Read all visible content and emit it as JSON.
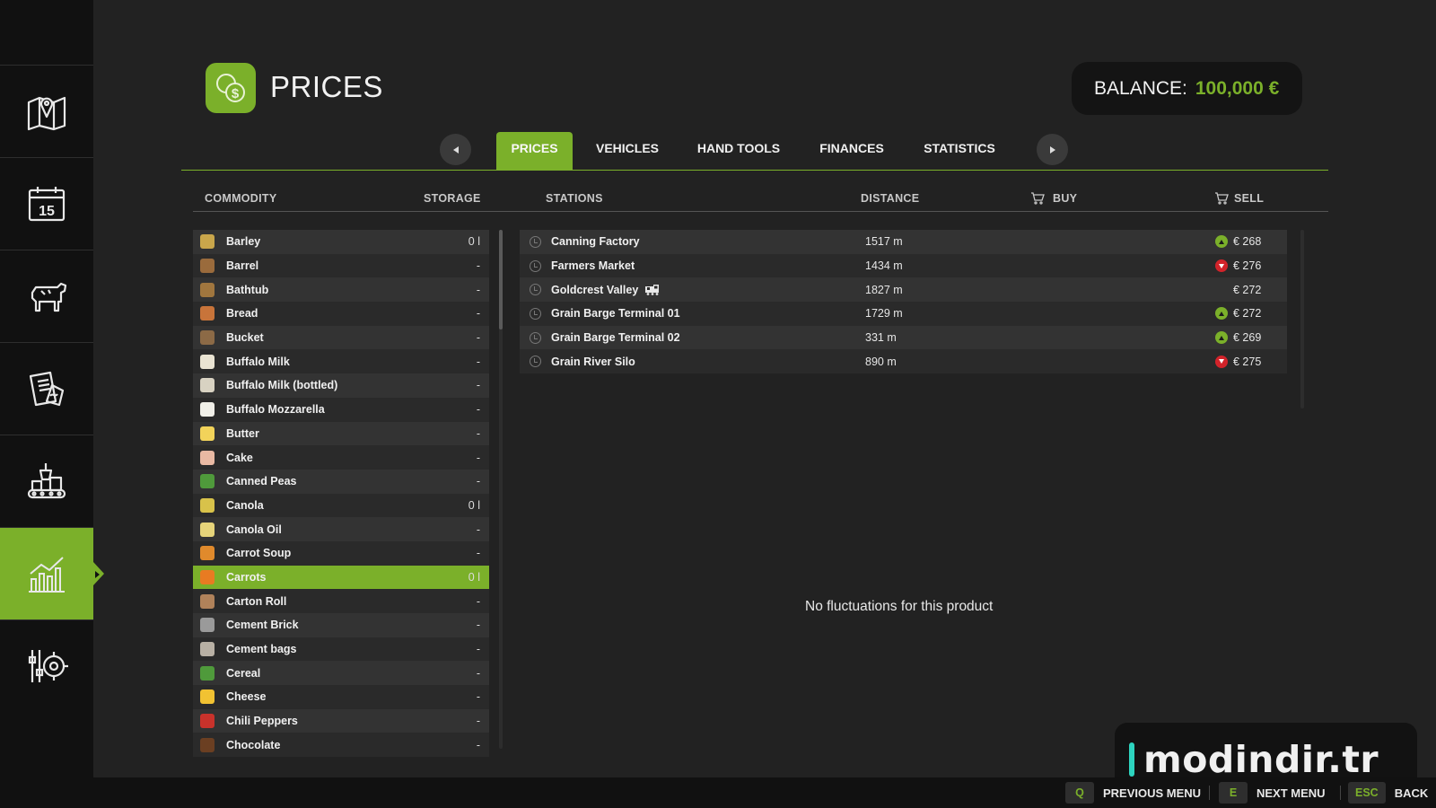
{
  "header": {
    "title": "PRICES",
    "balance_label": "BALANCE:",
    "balance_value": "100,000 €"
  },
  "sidebar": {
    "items": [
      {
        "icon": "map-icon"
      },
      {
        "icon": "calendar-icon"
      },
      {
        "icon": "animals-icon"
      },
      {
        "icon": "contracts-icon"
      },
      {
        "icon": "production-icon"
      },
      {
        "icon": "prices-chart-icon",
        "active": true
      },
      {
        "icon": "settings-icon"
      }
    ],
    "calendar_day": "15"
  },
  "tabs": [
    {
      "label": "PRICES",
      "active": true
    },
    {
      "label": "VEHICLES"
    },
    {
      "label": "HAND TOOLS"
    },
    {
      "label": "FINANCES"
    },
    {
      "label": "STATISTICS"
    }
  ],
  "columns": {
    "commodity": "COMMODITY",
    "storage": "STORAGE",
    "stations": "STATIONS",
    "distance": "DISTANCE",
    "buy": "BUY",
    "sell": "SELL"
  },
  "commodities": [
    {
      "name": "Barley",
      "storage": "0 l",
      "color": "#c9a64b"
    },
    {
      "name": "Barrel",
      "storage": "-",
      "color": "#9a6b3c"
    },
    {
      "name": "Bathtub",
      "storage": "-",
      "color": "#a0763e"
    },
    {
      "name": "Bread",
      "storage": "-",
      "color": "#c8743a"
    },
    {
      "name": "Bucket",
      "storage": "-",
      "color": "#8c6a46"
    },
    {
      "name": "Buffalo Milk",
      "storage": "-",
      "color": "#e9e3d2"
    },
    {
      "name": "Buffalo Milk (bottled)",
      "storage": "-",
      "color": "#d8d2c2"
    },
    {
      "name": "Buffalo Mozzarella",
      "storage": "-",
      "color": "#f0efe8"
    },
    {
      "name": "Butter",
      "storage": "-",
      "color": "#f2d35a"
    },
    {
      "name": "Cake",
      "storage": "-",
      "color": "#e9b9a3"
    },
    {
      "name": "Canned Peas",
      "storage": "-",
      "color": "#4f9a3b"
    },
    {
      "name": "Canola",
      "storage": "0 l",
      "color": "#d8c24a"
    },
    {
      "name": "Canola Oil",
      "storage": "-",
      "color": "#e6d47a"
    },
    {
      "name": "Carrot Soup",
      "storage": "-",
      "color": "#e08a2c"
    },
    {
      "name": "Carrots",
      "storage": "0 l",
      "color": "#e87b22",
      "selected": true
    },
    {
      "name": "Carton Roll",
      "storage": "-",
      "color": "#b0825a"
    },
    {
      "name": "Cement Brick",
      "storage": "-",
      "color": "#9a9a9a"
    },
    {
      "name": "Cement bags",
      "storage": "-",
      "color": "#b8b0a4"
    },
    {
      "name": "Cereal",
      "storage": "-",
      "color": "#4f9a3b"
    },
    {
      "name": "Cheese",
      "storage": "-",
      "color": "#f1c232"
    },
    {
      "name": "Chili Peppers",
      "storage": "-",
      "color": "#c8322b"
    },
    {
      "name": "Chocolate",
      "storage": "-",
      "color": "#6b3f22"
    }
  ],
  "stations": [
    {
      "name": "Canning Factory",
      "distance": "1517 m",
      "trend": "up",
      "price": "€ 268",
      "train": false
    },
    {
      "name": "Farmers Market",
      "distance": "1434 m",
      "trend": "down",
      "price": "€ 276",
      "train": false
    },
    {
      "name": "Goldcrest Valley",
      "distance": "1827 m",
      "trend": "none",
      "price": "€ 272",
      "train": true
    },
    {
      "name": "Grain Barge Terminal 01",
      "distance": "1729 m",
      "trend": "up",
      "price": "€ 272",
      "train": false
    },
    {
      "name": "Grain Barge Terminal 02",
      "distance": "331 m",
      "trend": "up",
      "price": "€ 269",
      "train": false
    },
    {
      "name": "Grain River Silo",
      "distance": "890 m",
      "trend": "down",
      "price": "€ 275",
      "train": false
    }
  ],
  "empty_message": "No fluctuations for this product",
  "watermark": "modindir.tr",
  "hints": [
    {
      "key": "Q",
      "label": "PREVIOUS MENU"
    },
    {
      "key": "E",
      "label": "NEXT MENU"
    },
    {
      "key": "ESC",
      "label": "BACK"
    }
  ],
  "colors": {
    "accent": "#7bb02a",
    "trend_up": "#7bb02a",
    "trend_down": "#d2232a",
    "background": "#222222"
  }
}
